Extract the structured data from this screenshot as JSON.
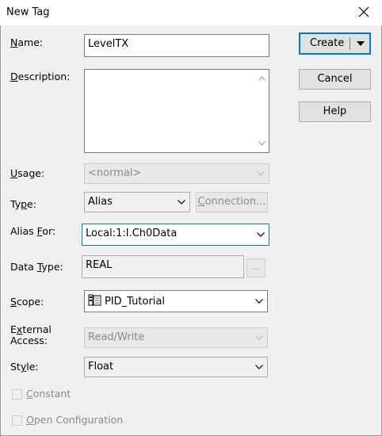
{
  "window": {
    "title": "New Tag"
  },
  "labels": {
    "name_hot": "N",
    "name_rest": "ame:",
    "description_hot": "D",
    "description_rest": "escription:",
    "usage_hot": "U",
    "usage_rest": "sage:",
    "type_pre": "Ty",
    "type_hot": "p",
    "type_rest": "e:",
    "alias_pre": "Alias ",
    "alias_hot": "F",
    "alias_rest": "or:",
    "datatype_pre": "Data ",
    "datatype_hot": "T",
    "datatype_rest": "ype:",
    "scope_hot": "S",
    "scope_rest": "cope:",
    "external_line1_pre": "E",
    "external_line1_hot": "x",
    "external_line1_rest": "ternal",
    "external_line2": "Access:",
    "style_pre": "St",
    "style_hot": "y",
    "style_rest": "le:"
  },
  "fields": {
    "name_value": "LevelTX",
    "description_value": "",
    "usage_value": "<normal>",
    "type_value": "Alias",
    "alias_for_value": "Local:1:I.Ch0Data",
    "data_type_value": "REAL",
    "scope_value": "PID_Tutorial",
    "external_access_value": "Read/Write",
    "style_value": "Float"
  },
  "buttons": {
    "create": "Create",
    "cancel": "Cancel",
    "help": "Help",
    "connection_hot": "C",
    "connection_rest": "onnection...",
    "browse": "..."
  },
  "checkboxes": {
    "constant_hot": "C",
    "constant_rest": "onstant",
    "open_config_hot": "O",
    "open_config_rest": "pen Configuration"
  },
  "icons": {
    "close": "close-icon",
    "dropdown": "chevron-down-icon",
    "scope_icon": "controller-tag-icon",
    "scroll_up": "scroll-up-arrow-icon",
    "scroll_down": "scroll-down-arrow-icon"
  },
  "colors": {
    "accent": "#0078d7",
    "disabled_text": "#8a8a8a"
  }
}
